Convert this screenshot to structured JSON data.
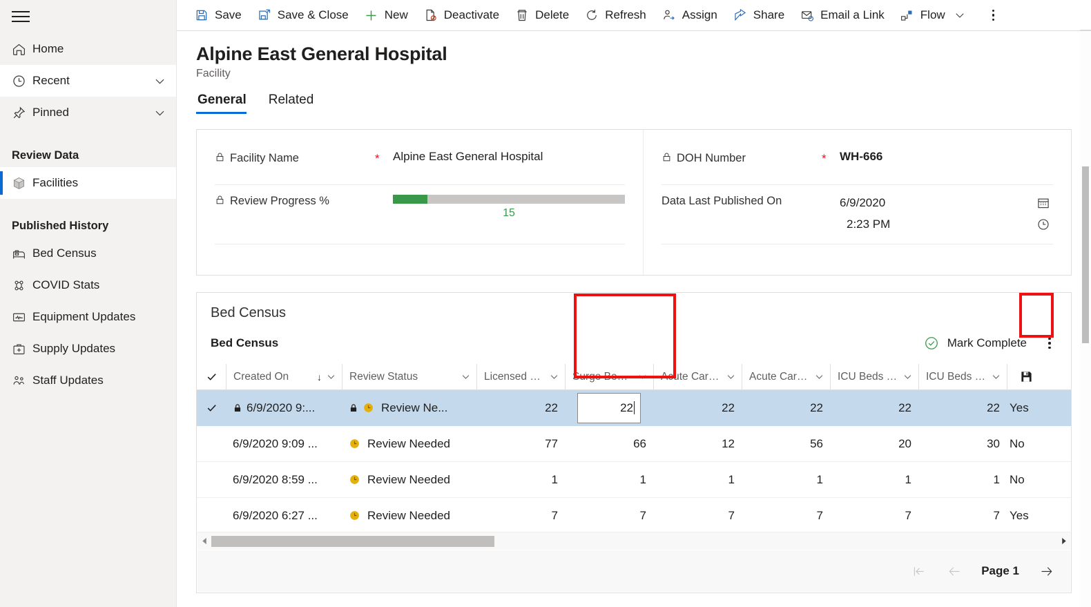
{
  "sidebar": {
    "menu_icon": "hamburger-icon",
    "items": [
      {
        "label": "Home",
        "icon": "home-icon",
        "expandable": false
      },
      {
        "label": "Recent",
        "icon": "clock-icon",
        "expandable": true
      },
      {
        "label": "Pinned",
        "icon": "pin-icon",
        "expandable": true
      }
    ],
    "groups": [
      {
        "title": "Review Data",
        "items": [
          {
            "label": "Facilities",
            "icon": "cube-icon",
            "selected": true
          }
        ]
      },
      {
        "title": "Published History",
        "items": [
          {
            "label": "Bed Census",
            "icon": "bed-icon",
            "selected": false
          },
          {
            "label": "COVID Stats",
            "icon": "virus-icon",
            "selected": false
          },
          {
            "label": "Equipment Updates",
            "icon": "monitor-icon",
            "selected": false
          },
          {
            "label": "Supply Updates",
            "icon": "medkit-icon",
            "selected": false
          },
          {
            "label": "Staff Updates",
            "icon": "people-icon",
            "selected": false
          }
        ]
      }
    ]
  },
  "commandbar": {
    "buttons": [
      {
        "label": "Save",
        "icon": "save-icon"
      },
      {
        "label": "Save & Close",
        "icon": "save-close-icon"
      },
      {
        "label": "New",
        "icon": "plus-icon"
      },
      {
        "label": "Deactivate",
        "icon": "deactivate-icon"
      },
      {
        "label": "Delete",
        "icon": "trash-icon"
      },
      {
        "label": "Refresh",
        "icon": "refresh-icon"
      },
      {
        "label": "Assign",
        "icon": "assign-person-icon"
      },
      {
        "label": "Share",
        "icon": "share-icon"
      },
      {
        "label": "Email a Link",
        "icon": "email-link-icon"
      },
      {
        "label": "Flow",
        "icon": "flow-icon",
        "chevron": true
      }
    ],
    "overflow_icon": "more-vertical-icon"
  },
  "record": {
    "title": "Alpine East General Hospital",
    "subtitle": "Facility",
    "tabs": [
      {
        "label": "General",
        "active": true
      },
      {
        "label": "Related",
        "active": false
      }
    ]
  },
  "form": {
    "facility_name": {
      "label": "Facility Name",
      "required": "*",
      "value": "Alpine East General Hospital",
      "locked": true
    },
    "review_progress": {
      "label": "Review Progress %",
      "value": "15",
      "percent": 15,
      "locked": true,
      "fill_color": "#3a9949",
      "track_color": "#c8c6c4"
    },
    "doh_number": {
      "label": "DOH Number",
      "required": "*",
      "value": "WH-666",
      "locked": true
    },
    "data_last_published": {
      "label": "Data Last Published On",
      "date": "6/9/2020",
      "time": "2:23 PM",
      "date_icon": "calendar-icon",
      "time_icon": "clock-icon"
    }
  },
  "grid": {
    "section_title": "Bed Census",
    "subgrid_title": "Bed Census",
    "mark_complete_label": "Mark Complete",
    "mark_complete_icon": "check-circle-icon",
    "kebab_icon": "more-vertical-icon",
    "save_column_icon": "save-icon",
    "select_all_icon": "checkmark-icon",
    "columns": [
      {
        "label": "Created On",
        "sorted": true,
        "sort_arrow": "↓"
      },
      {
        "label": "Review Status"
      },
      {
        "label": "Licensed B..."
      },
      {
        "label": "Surge Beds..."
      },
      {
        "label": "Acute Care ..."
      },
      {
        "label": "Acute Care ..."
      },
      {
        "label": "ICU Beds (..."
      },
      {
        "label": "ICU Beds (..."
      }
    ],
    "rows": [
      {
        "selected": true,
        "row_check_icon": "checkmark-icon",
        "created_on": "6/9/2020 9:...",
        "created_on_locked": true,
        "status_locked": true,
        "status_icon": "clock-badge-icon",
        "review_status": "Review Ne...",
        "licensed_beds": "22",
        "surge_beds": "22",
        "surge_beds_editing": true,
        "acute_care_1": "22",
        "acute_care_2": "22",
        "icu_beds_1": "22",
        "icu_beds_2": "22",
        "flag": "Yes"
      },
      {
        "selected": false,
        "created_on": "6/9/2020 9:09 ...",
        "created_on_locked": false,
        "status_locked": false,
        "status_icon": "clock-badge-icon",
        "review_status": "Review Needed",
        "licensed_beds": "77",
        "surge_beds": "66",
        "surge_beds_editing": false,
        "acute_care_1": "12",
        "acute_care_2": "56",
        "icu_beds_1": "20",
        "icu_beds_2": "30",
        "flag": "No"
      },
      {
        "selected": false,
        "created_on": "6/9/2020 8:59 ...",
        "created_on_locked": false,
        "status_locked": false,
        "status_icon": "clock-badge-icon",
        "review_status": "Review Needed",
        "licensed_beds": "1",
        "surge_beds": "1",
        "surge_beds_editing": false,
        "acute_care_1": "1",
        "acute_care_2": "1",
        "icu_beds_1": "1",
        "icu_beds_2": "1",
        "flag": "No"
      },
      {
        "selected": false,
        "created_on": "6/9/2020 6:27 ...",
        "created_on_locked": false,
        "status_locked": false,
        "status_icon": "clock-badge-icon",
        "review_status": "Review Needed",
        "licensed_beds": "7",
        "surge_beds": "7",
        "surge_beds_editing": false,
        "acute_care_1": "7",
        "acute_care_2": "7",
        "icu_beds_1": "7",
        "icu_beds_2": "7",
        "flag": "Yes"
      }
    ],
    "pager": {
      "first_icon": "page-first-icon",
      "prev_icon": "page-prev-icon",
      "label": "Page 1",
      "next_icon": "page-next-icon"
    }
  },
  "highlights": {
    "accent_color": "#ee1111",
    "boxes": [
      {
        "name": "surge-beds-column-highlight"
      },
      {
        "name": "grid-save-button-highlight"
      }
    ]
  }
}
